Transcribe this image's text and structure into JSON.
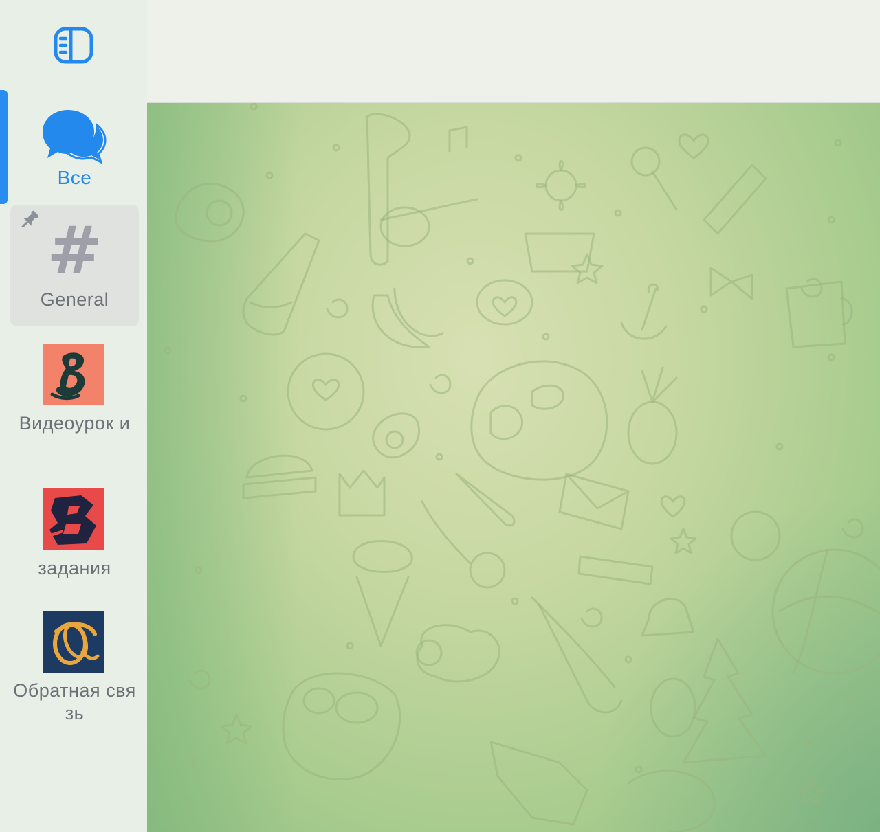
{
  "sidebar": {
    "folders": [
      {
        "id": "all",
        "label": "Все",
        "icon": "chat-bubbles-icon",
        "active": true
      },
      {
        "id": "general",
        "label": "General",
        "icon": "hash-icon",
        "pinned": true
      },
      {
        "id": "video",
        "label": "Видеоурок и",
        "icon": "letter-b-logo"
      },
      {
        "id": "tasks",
        "label": "задания",
        "icon": "letter-b-dark-logo"
      },
      {
        "id": "feedback",
        "label": "Обратная связь",
        "icon": "swirl-logo"
      }
    ],
    "toggle_icon": "sidebar-toggle-icon",
    "hash_glyph": "#"
  },
  "colors": {
    "accent": "#2389ec",
    "sidebar_bg": "#e8efe7",
    "header_bg": "#eef0ea",
    "chat_bg": "#c7d8a2"
  }
}
